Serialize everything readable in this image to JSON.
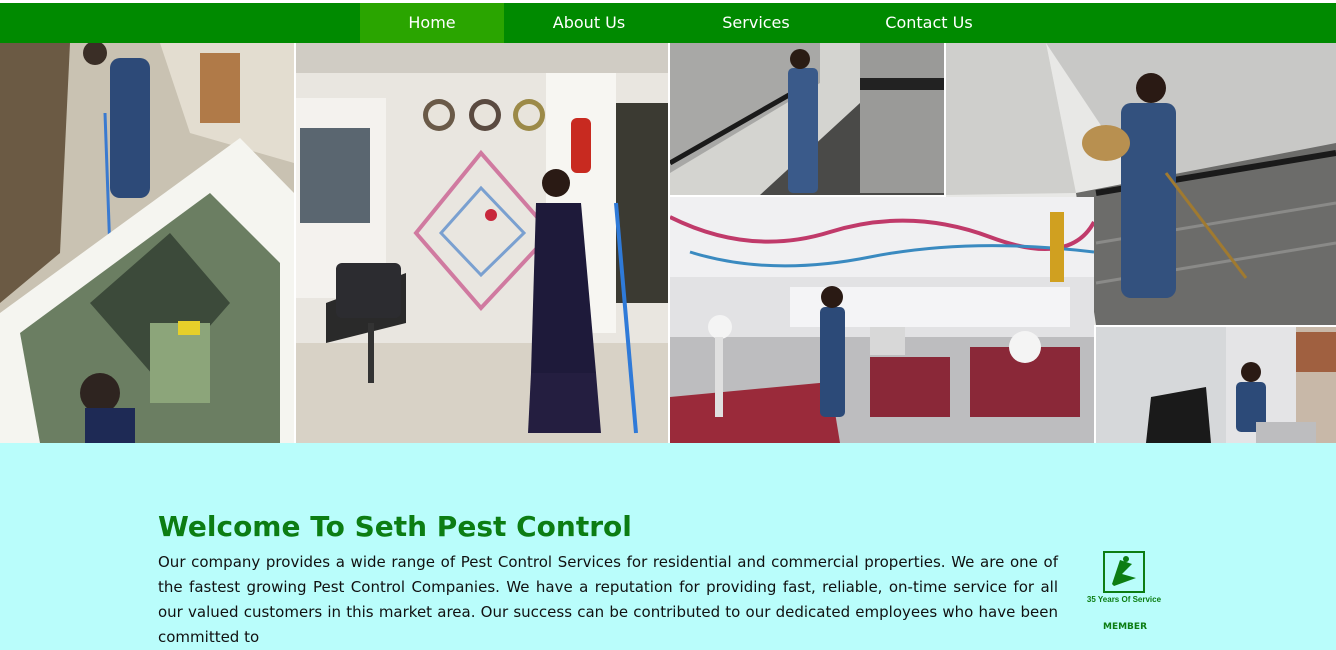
{
  "nav": {
    "items": [
      {
        "label": "Home",
        "active": true
      },
      {
        "label": "About Us",
        "active": false
      },
      {
        "label": "Services",
        "active": false
      },
      {
        "label": "Contact Us",
        "active": false
      }
    ]
  },
  "hero": {
    "slider_progress_percent": 80
  },
  "welcome": {
    "title": "Welcome To Seth Pest Control",
    "body": "Our company provides a wide range of Pest Control Services for residential and commercial properties. We are one of the fastest growing Pest Control Companies. We have a reputation for providing fast, reliable, on-time service for all our valued customers in this market area. Our success can be contributed to our dedicated employees who have been committed to"
  },
  "badge": {
    "text": "35 Years Of Service",
    "member_label": "MEMBER"
  },
  "colors": {
    "nav": "#008a00",
    "nav_active": "#2aa500",
    "page_bg": "#b9fdfb",
    "heading": "#0c7d13"
  }
}
